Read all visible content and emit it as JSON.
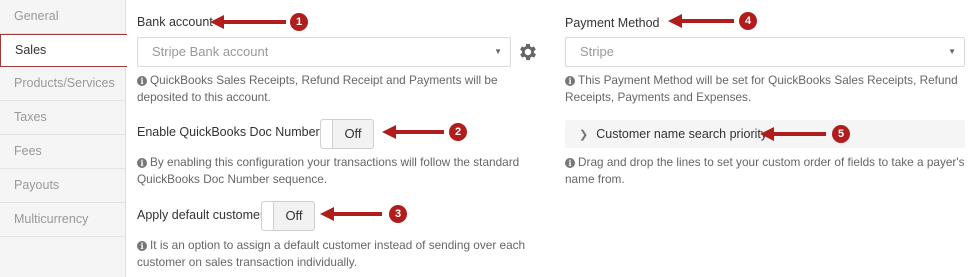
{
  "sidebar": {
    "items": [
      {
        "label": "General"
      },
      {
        "label": "Sales"
      },
      {
        "label": "Products/Services"
      },
      {
        "label": "Taxes"
      },
      {
        "label": "Fees"
      },
      {
        "label": "Payouts"
      },
      {
        "label": "Multicurrency"
      }
    ],
    "active": "Sales"
  },
  "bank_account": {
    "label": "Bank account",
    "selected": "Stripe Bank account",
    "help": "QuickBooks Sales Receipts, Refund Receipt and Payments will be deposited to this account."
  },
  "doc_numbers": {
    "label": "Enable QuickBooks Doc Numbers",
    "state": "Off",
    "help": "By enabling this configuration your transactions will follow the standard QuickBooks Doc Number sequence."
  },
  "default_customer": {
    "label": "Apply default customer",
    "state": "Off",
    "help": "It is an option to assign a default customer instead of sending over each customer on sales transaction individually."
  },
  "payment_method": {
    "label": "Payment Method",
    "selected": "Stripe",
    "help": "This Payment Method will be set for QuickBooks Sales Receipts, Refund Receipts, Payments and Expenses."
  },
  "name_priority": {
    "label": "Customer name search priority",
    "help": "Drag and drop the lines to set your custom order of fields to take a payer's name from."
  },
  "annotations": [
    "1",
    "2",
    "3",
    "4",
    "5"
  ],
  "colors": {
    "annotation": "#b11d1d",
    "active_border": "#9e3a38"
  },
  "icons": {
    "settings": "gear-icon",
    "info": "info-icon",
    "expand": "chevron-right-icon",
    "dropdown": "caret-down-icon"
  }
}
